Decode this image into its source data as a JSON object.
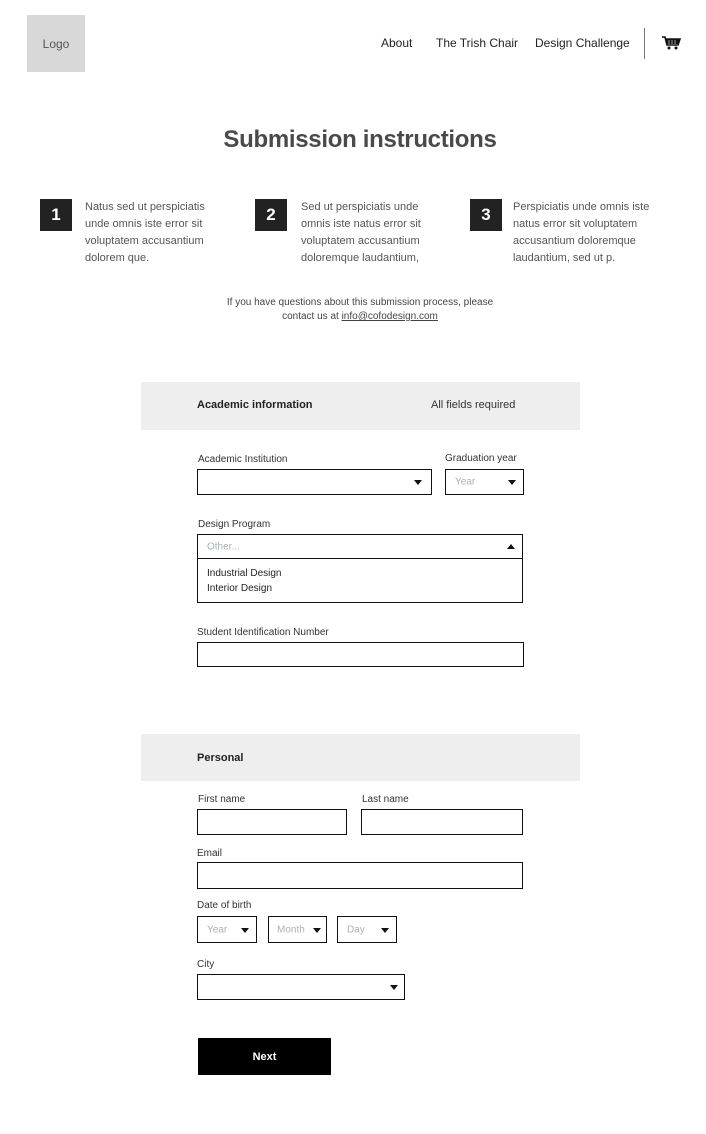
{
  "header": {
    "logo": "Logo",
    "nav": [
      {
        "label": "About"
      },
      {
        "label": "The Trish Chair"
      },
      {
        "label": "Design Challenge"
      }
    ],
    "cart_icon": "shopping-cart-icon"
  },
  "page": {
    "title": "Submission instructions"
  },
  "steps": [
    {
      "number": "1",
      "text": "Natus sed ut perspiciatis unde omnis iste  error sit voluptatem accusantium dolorem que."
    },
    {
      "number": "2",
      "text": "Sed ut perspiciatis unde omnis iste natus error sit voluptatem accusantium doloremque laudantium,"
    },
    {
      "number": "3",
      "text": "Perspiciatis unde omnis iste natus error sit voluptatem accusantium doloremque laudantium, sed ut p."
    }
  ],
  "contact": {
    "text_line1": "If you have questions about this submission process, please",
    "text_prefix": "contact us at ",
    "email": "info@cofodesign.com"
  },
  "academic": {
    "title": "Academic information",
    "note": "All fields required",
    "institution": {
      "label": "Academic Institution",
      "value": ""
    },
    "graduation_year": {
      "label": "Graduation year",
      "placeholder": "Year"
    },
    "design_program": {
      "label": "Design Program",
      "placeholder": "Other...",
      "options": [
        "Industrial Design",
        "Interior Design"
      ]
    },
    "student_id": {
      "label": "Student Identification Number",
      "value": ""
    }
  },
  "personal": {
    "title": "Personal",
    "first_name": {
      "label": "First name",
      "value": ""
    },
    "last_name": {
      "label": "Last name",
      "value": ""
    },
    "email": {
      "label": "Email",
      "value": ""
    },
    "dob": {
      "label": "Date of birth",
      "year_placeholder": "Year",
      "month_placeholder": "Month",
      "day_placeholder": "Day"
    },
    "city": {
      "label": "City",
      "value": ""
    }
  },
  "actions": {
    "next_label": "Next"
  }
}
